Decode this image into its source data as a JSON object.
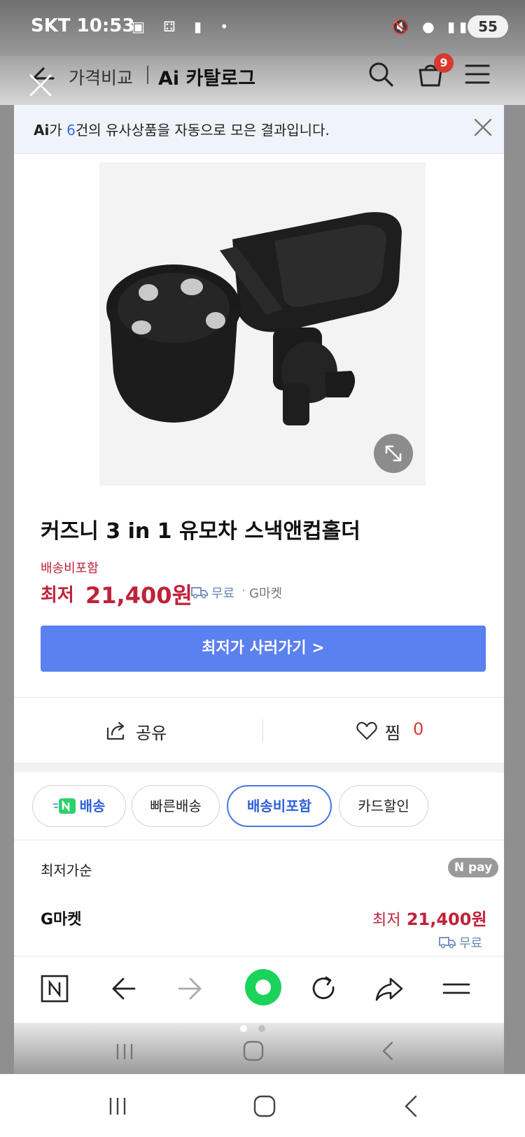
{
  "status_bar": {
    "carrier": "SKT",
    "time": "10:53",
    "battery": "55"
  },
  "header": {
    "breadcrumb_1": "가격비교",
    "breadcrumb_2": "Ai 카탈로그",
    "cart_count": "9"
  },
  "notice": {
    "prefix": "Ai",
    "text_a": "가 ",
    "count": "6",
    "text_b": "건의 유사상품을 자동으로 모은 결과입니다."
  },
  "product": {
    "title": "커즈니 3 in 1 유모차 스낵앤컵홀더",
    "shipping_included": "배송비포함",
    "price_label": "최저",
    "price_value": "21,400원",
    "free_shipping": "무료",
    "separator": "·",
    "seller": "G마켓",
    "cta_label": "최저가 사러가기 >"
  },
  "actions": {
    "share_label": "공유",
    "like_label": "찜",
    "like_count": "0"
  },
  "filters": [
    {
      "label": "배송"
    },
    {
      "label": "빠른배송"
    },
    {
      "label": "배송비포함"
    },
    {
      "label": "카드할인"
    }
  ],
  "offers": {
    "sort_label": "최저가순",
    "npay_label": "N pay",
    "rows": [
      {
        "seller": "G마켓",
        "price_label": "최저",
        "price": "21,400원",
        "shipping": "무료"
      }
    ]
  },
  "colors": {
    "accent_blue": "#5b80ef",
    "price_red": "#c0223a",
    "naver_green": "#1bd35b"
  }
}
